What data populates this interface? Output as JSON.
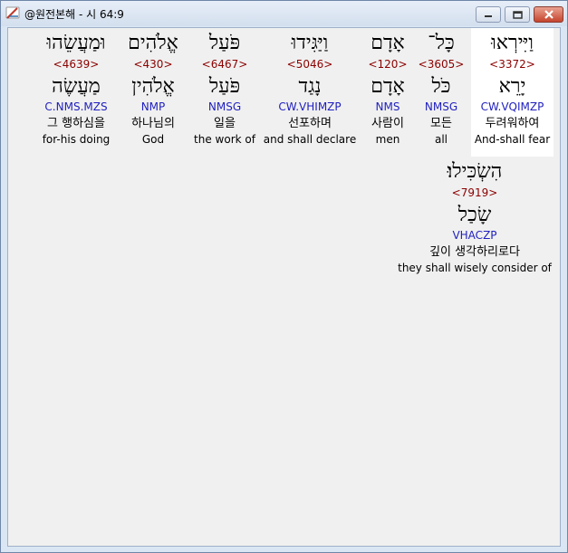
{
  "window": {
    "title": "@원전본해 - 시 64:9"
  },
  "words": [
    {
      "hebrew": "וַיִּירְאוּ",
      "strong": "<3372>",
      "lemma": "יָרֵא",
      "morph": "CW.VQIMZP",
      "korean": "두려워하여",
      "english": "And-shall fear"
    },
    {
      "hebrew": "כָּל־",
      "strong": "<3605>",
      "lemma": "כֹּל",
      "morph": "NMSG",
      "korean": "모든",
      "english": "all"
    },
    {
      "hebrew": "אָדָם",
      "strong": "<120>",
      "lemma": "אָדָם",
      "morph": "NMS",
      "korean": "사람이",
      "english": "men"
    },
    {
      "hebrew": "וַיַּגִּידוּ",
      "strong": "<5046>",
      "lemma": "נָגַד",
      "morph": "CW.VHIMZP",
      "korean": "선포하며",
      "english": "and shall declare"
    },
    {
      "hebrew": "פֹּעַל",
      "strong": "<6467>",
      "lemma": "פֹּעַל",
      "morph": "NMSG",
      "korean": "일을",
      "english": "the work of"
    },
    {
      "hebrew": "אֱלֹהִים",
      "strong": "<430>",
      "lemma": "אֱלֹהִין",
      "morph": "NMP",
      "korean": "하나님의",
      "english": "God"
    },
    {
      "hebrew": "וּמַעֲשֵׂהוּ",
      "strong": "<4639>",
      "lemma": "מַעֲשֶׂה",
      "morph": "C.NMS.MZS",
      "korean": "그 행하심을",
      "english": "for-his doing"
    },
    {
      "hebrew": "הִשְׂכִּילוּ׃",
      "strong": "<7919>",
      "lemma": "שָׂכַל",
      "morph": "VHACZP",
      "korean": "깊이 생각하리로다",
      "english": "they shall wisely consider of"
    }
  ]
}
